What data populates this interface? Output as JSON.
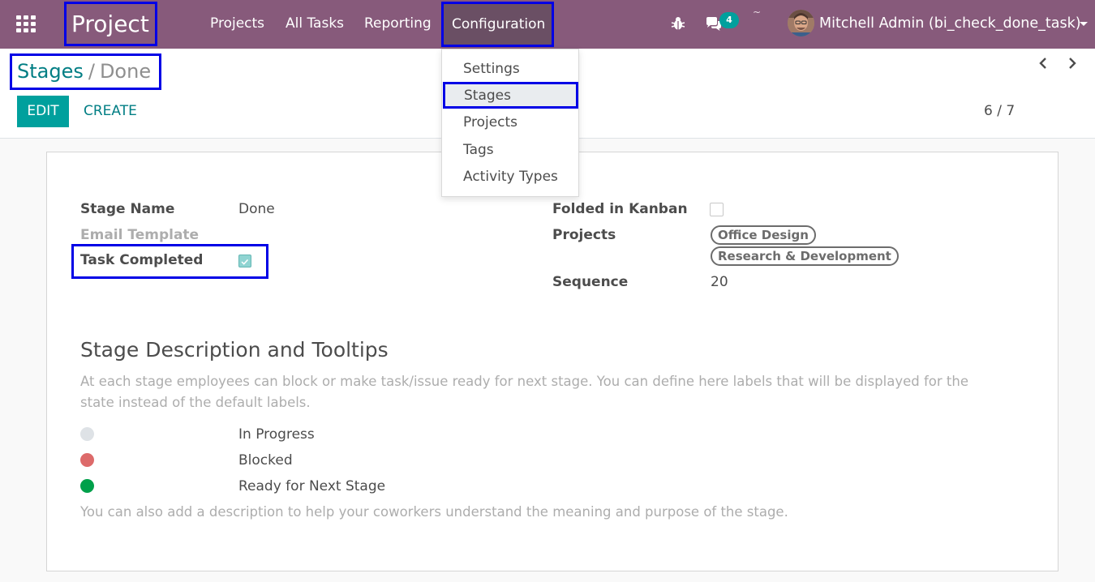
{
  "navbar": {
    "app_name": "Project",
    "menu": [
      "Projects",
      "All Tasks",
      "Reporting"
    ],
    "active_menu": "Configuration",
    "chat_count": "4",
    "clock_mark": "~",
    "user_name": "Mitchell Admin (bi_check_done_task)",
    "bg_color": "#875a7b"
  },
  "dropdown": {
    "items": [
      "Settings",
      "Stages",
      "Projects",
      "Tags",
      "Activity Types"
    ],
    "active_item": "Stages"
  },
  "control": {
    "breadcrumb_parent": "Stages",
    "breadcrumb_separator": "/",
    "breadcrumb_current": "Done",
    "edit_label": "EDIT",
    "create_label": "CREATE",
    "pager": "6 / 7"
  },
  "form": {
    "stage_name_label": "Stage Name",
    "stage_name_value": "Done",
    "email_template_label": "Email Template",
    "task_completed_label": "Task Completed",
    "task_completed_checked": true,
    "folded_label": "Folded in Kanban",
    "folded_checked": false,
    "projects_label": "Projects",
    "projects_tags": [
      "Office Design",
      "Research & Development"
    ],
    "sequence_label": "Sequence",
    "sequence_value": "20"
  },
  "description": {
    "title": "Stage Description and Tooltips",
    "help": "At each stage employees can block or make task/issue ready for next stage. You can define here labels that will be displayed for the state instead of the default labels.",
    "states": [
      {
        "label": "In Progress",
        "color": "#dee2e6"
      },
      {
        "label": "Blocked",
        "color": "#dd6a6a"
      },
      {
        "label": "Ready for Next Stage",
        "color": "#00a04a"
      }
    ],
    "help2": "You can also add a description to help your coworkers understand the meaning and purpose of the stage."
  }
}
